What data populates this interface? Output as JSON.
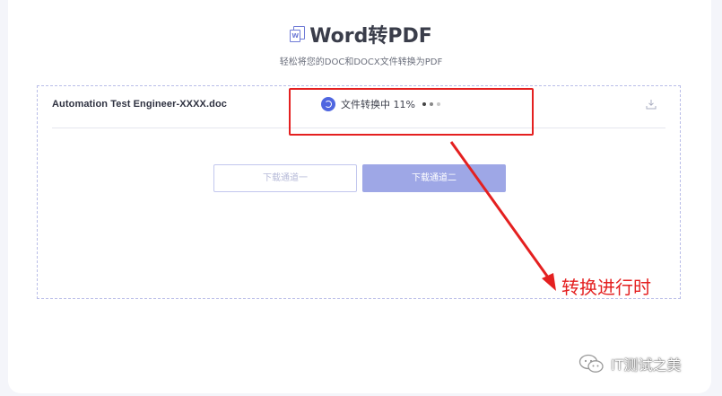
{
  "header": {
    "title": "Word转PDF",
    "subtitle": "轻松将您的DOC和DOCX文件转换为PDF",
    "icon": "word-doc-icon"
  },
  "file": {
    "name": "Automation Test Engineer-XXXX.doc",
    "status": "文件转换中 11%",
    "progress_percent": 11,
    "status_icon": "sync-icon",
    "download_icon": "download-icon"
  },
  "buttons": {
    "channel1": "下载通道一",
    "channel2": "下载通道二"
  },
  "annotation": {
    "text": "转换进行时",
    "color": "#e42020"
  },
  "watermark": {
    "text": "IT测试之美",
    "icon": "wechat-icon"
  },
  "colors": {
    "accent": "#4f66e0",
    "button_primary": "#9ea7e6",
    "panel_border": "#b9bde8"
  }
}
